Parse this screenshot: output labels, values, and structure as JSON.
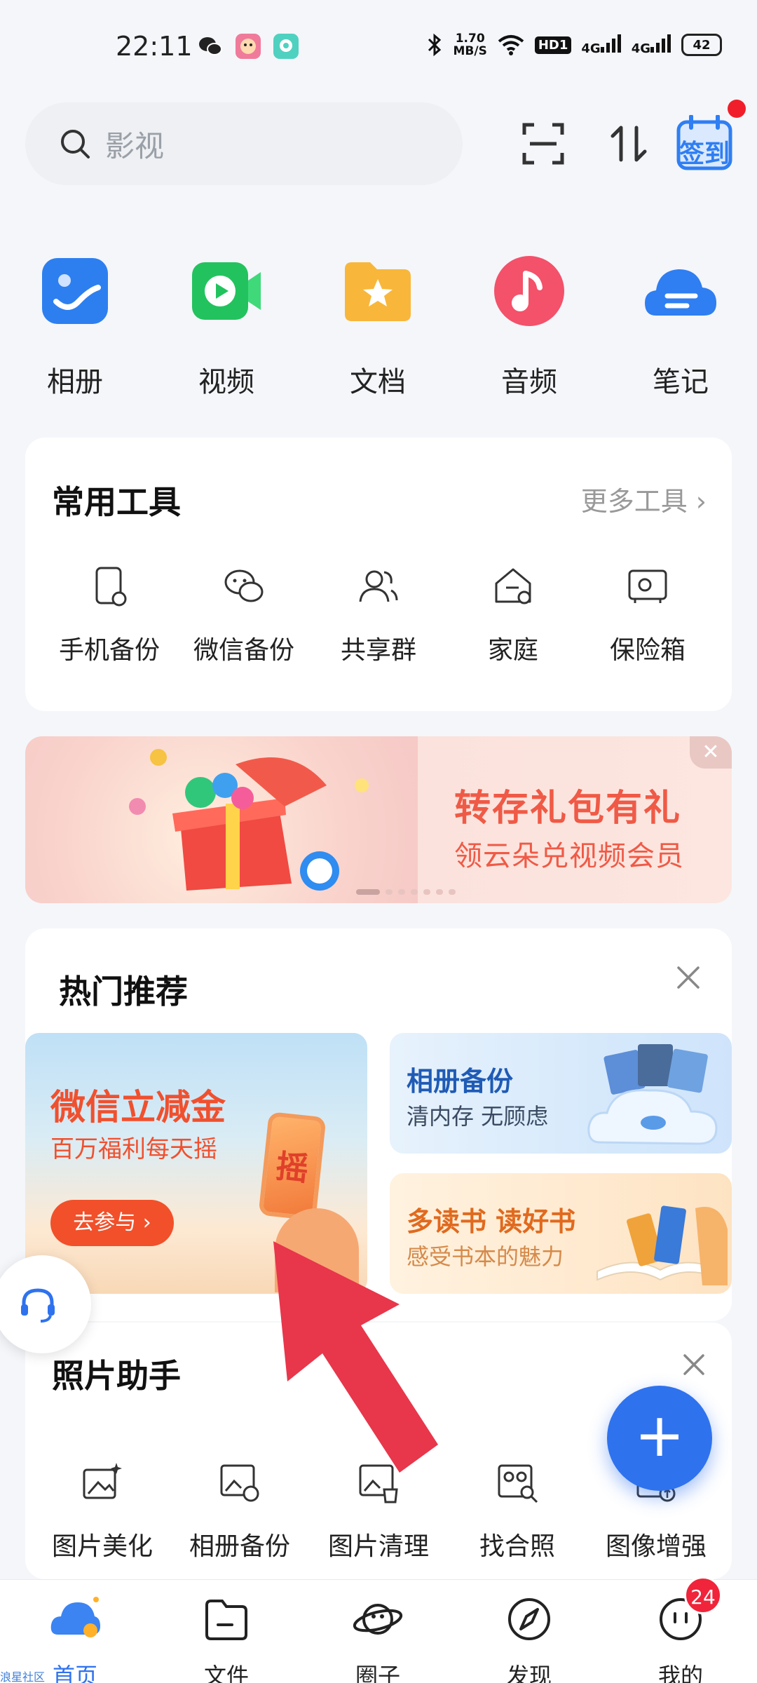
{
  "status_bar": {
    "time": "22:11",
    "net_speed_value": "1.70",
    "net_speed_unit": "MB/S",
    "hd": "HD1",
    "sig1": "4G",
    "sig2": "4G",
    "battery": "42"
  },
  "search": {
    "placeholder": "影视"
  },
  "header": {
    "checkin_label": "签到"
  },
  "categories": [
    {
      "label": "相册",
      "icon": "photo-album-icon",
      "color": "#2d7ff0"
    },
    {
      "label": "视频",
      "icon": "video-icon",
      "color": "#22c35e"
    },
    {
      "label": "文档",
      "icon": "document-folder-icon",
      "color": "#f8b73a"
    },
    {
      "label": "音频",
      "icon": "music-icon",
      "color": "#f4516a"
    },
    {
      "label": "笔记",
      "icon": "note-cloud-icon",
      "color": "#2f7ef2"
    }
  ],
  "tools_card": {
    "title": "常用工具",
    "more": "更多工具",
    "items": [
      {
        "label": "手机备份",
        "icon": "phone-backup-icon"
      },
      {
        "label": "微信备份",
        "icon": "wechat-backup-icon"
      },
      {
        "label": "共享群",
        "icon": "shared-group-icon"
      },
      {
        "label": "家庭",
        "icon": "family-home-icon"
      },
      {
        "label": "保险箱",
        "icon": "safe-box-icon"
      }
    ]
  },
  "banner": {
    "title": "转存礼包有礼",
    "subtitle": "领云朵兑视频会员"
  },
  "hot": {
    "title": "热门推荐",
    "big": {
      "title": "微信立减金",
      "subtitle": "百万福利每天摇",
      "button": "去参与",
      "shake": "摇"
    },
    "small": [
      {
        "title": "相册备份",
        "subtitle": "清内存 无顾虑",
        "title_color": "#1f5bb5",
        "sub_color": "#3a4a62"
      },
      {
        "title": "多读书 读好书",
        "subtitle": "感受书本的魅力",
        "title_color": "#e06a1e",
        "sub_color": "#d58a4a"
      }
    ]
  },
  "photo_helper": {
    "title": "照片助手",
    "items": [
      {
        "label": "图片美化",
        "icon": "image-beautify-icon"
      },
      {
        "label": "相册备份",
        "icon": "album-backup-icon"
      },
      {
        "label": "图片清理",
        "icon": "image-clean-icon"
      },
      {
        "label": "找合照",
        "icon": "find-group-photo-icon"
      },
      {
        "label": "图像增强",
        "icon": "image-enhance-icon"
      }
    ]
  },
  "bottom_nav": [
    {
      "label": "首页",
      "icon": "home-cloud-icon",
      "active": true
    },
    {
      "label": "文件",
      "icon": "file-folder-icon"
    },
    {
      "label": "圈子",
      "icon": "planet-icon"
    },
    {
      "label": "发现",
      "icon": "compass-icon"
    },
    {
      "label": "我的",
      "icon": "profile-face-icon"
    }
  ],
  "badge_count": "24",
  "corner_text": "浪星社区"
}
